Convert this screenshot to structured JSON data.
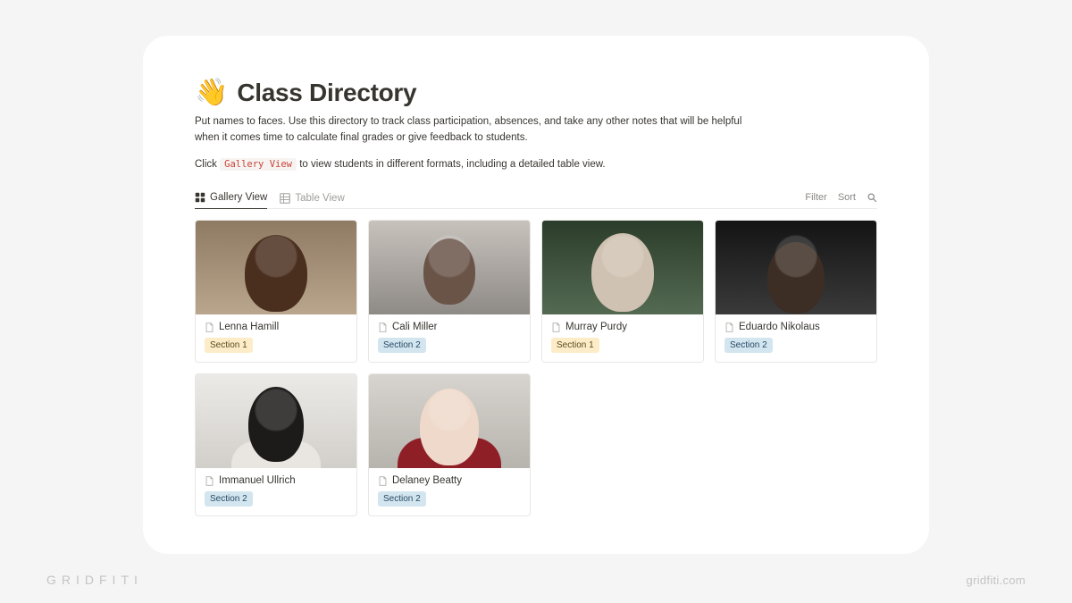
{
  "header": {
    "emoji": "👋",
    "title": "Class Directory",
    "description": "Put names to faces. Use this directory to track class participation, absences, and take any other notes that will be helpful when it comes time to calculate final grades or give feedback to students.",
    "hint_prefix": "Click ",
    "hint_code": "Gallery View",
    "hint_suffix": " to view students in different formats, including a detailed table view."
  },
  "views": {
    "tabs": [
      {
        "label": "Gallery View",
        "active": true
      },
      {
        "label": "Table View",
        "active": false
      }
    ],
    "controls": {
      "filter": "Filter",
      "sort": "Sort"
    }
  },
  "students": [
    {
      "name": "Lenna Hamill",
      "section": "Section 1",
      "section_color": "yellow"
    },
    {
      "name": "Cali Miller",
      "section": "Section 2",
      "section_color": "blue"
    },
    {
      "name": "Murray Purdy",
      "section": "Section 1",
      "section_color": "yellow"
    },
    {
      "name": "Eduardo Nikolaus",
      "section": "Section 2",
      "section_color": "blue"
    },
    {
      "name": "Immanuel Ullrich",
      "section": "Section 2",
      "section_color": "blue"
    },
    {
      "name": "Delaney Beatty",
      "section": "Section 2",
      "section_color": "blue"
    }
  ],
  "branding": {
    "left": "GRIDFITI",
    "right": "gridfiti.com"
  }
}
